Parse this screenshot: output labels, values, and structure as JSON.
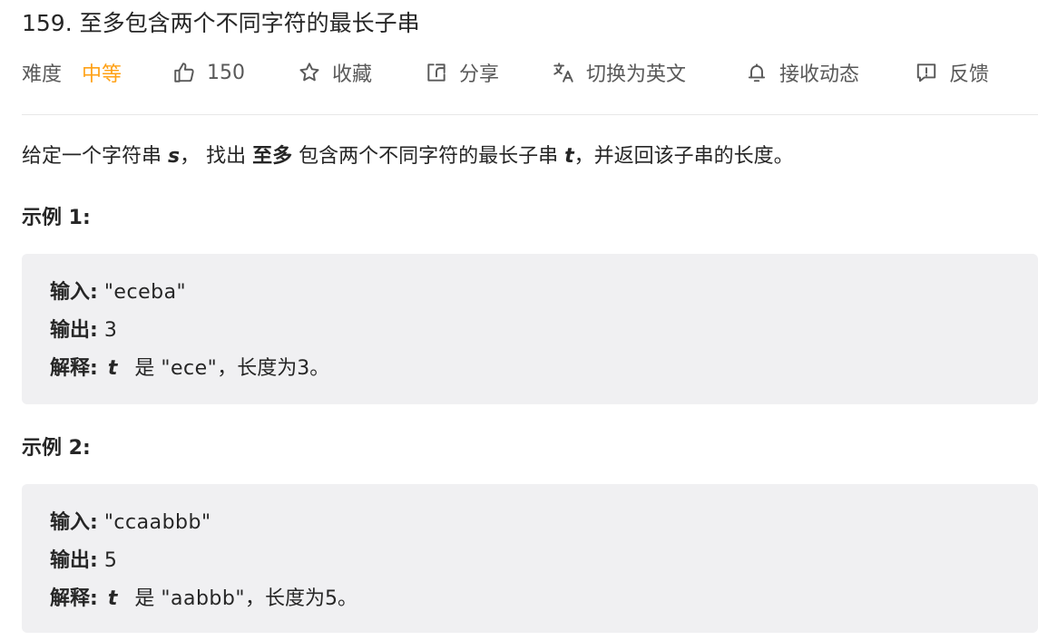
{
  "problem": {
    "title": "159. 至多包含两个不同字符的最长子串"
  },
  "meta": {
    "difficulty_label": "难度",
    "difficulty_value": "中等",
    "likes": "150",
    "favorite_label": "收藏",
    "share_label": "分享",
    "translate_label": "切换为英文",
    "notify_label": "接收动态",
    "feedback_label": "反馈",
    "colors": {
      "difficulty_medium": "#ffa116",
      "text_secondary": "#595959",
      "example_bg": "#f0f0f2"
    },
    "icons": {
      "likes": "thumbs-up-icon",
      "favorite": "star-icon",
      "share": "share-icon",
      "translate": "translate-icon",
      "notify": "bell-icon",
      "feedback": "feedback-icon"
    }
  },
  "description": {
    "part1": "给定一个字符串 ",
    "var_s": "s",
    "part2": "， 找出 ",
    "emphasis": "至多",
    "part3": " 包含两个不同字符的最长子串 ",
    "var_t": "t",
    "part4": "，并返回该子串的长度。"
  },
  "examples": [
    {
      "title": "示例 1:",
      "input_label": "输入:",
      "input_value": "\"eceba\"",
      "output_label": "输出:",
      "output_value": "3",
      "explain_label": "解释:",
      "explain_var": "t",
      "explain_is": "是",
      "explain_value": "\"ece\"",
      "explain_tail": "，长度为3。"
    },
    {
      "title": "示例 2:",
      "input_label": "输入:",
      "input_value": "\"ccaabbb\"",
      "output_label": "输出:",
      "output_value": "5",
      "explain_label": "解释:",
      "explain_var": "t",
      "explain_is": "是",
      "explain_value": "\"aabbb\"",
      "explain_tail": "，长度为5。"
    }
  ]
}
